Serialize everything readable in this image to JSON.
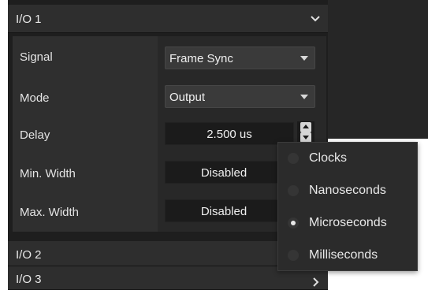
{
  "sections": [
    {
      "title": "I/O 1",
      "expanded": true
    },
    {
      "title": "I/O 2",
      "expanded": false
    },
    {
      "title": "I/O 3",
      "expanded": false
    }
  ],
  "io1": {
    "signal": {
      "label": "Signal",
      "value": "Frame Sync"
    },
    "mode": {
      "label": "Mode",
      "value": "Output"
    },
    "delay": {
      "label": "Delay",
      "value": "2.500 us"
    },
    "min_width": {
      "label": "Min. Width",
      "value": "Disabled"
    },
    "max_width": {
      "label": "Max. Width",
      "value": "Disabled"
    }
  },
  "unit_menu": {
    "options": [
      "Clocks",
      "Nanoseconds",
      "Microseconds",
      "Milliseconds"
    ],
    "selected": "Microseconds"
  },
  "icons": {
    "expand": "chevron-down-icon",
    "collapse": "chevron-right-icon",
    "dropdown": "caret-down-icon",
    "spinner": "spinner-up-down-icon"
  },
  "colors": {
    "panel_bg": "#1e1e1e",
    "header_bg": "#2e2e2e",
    "dropdown_bg": "#3a3a3a",
    "field_bg": "#1b1b1b",
    "text": "#e6e6e6"
  }
}
